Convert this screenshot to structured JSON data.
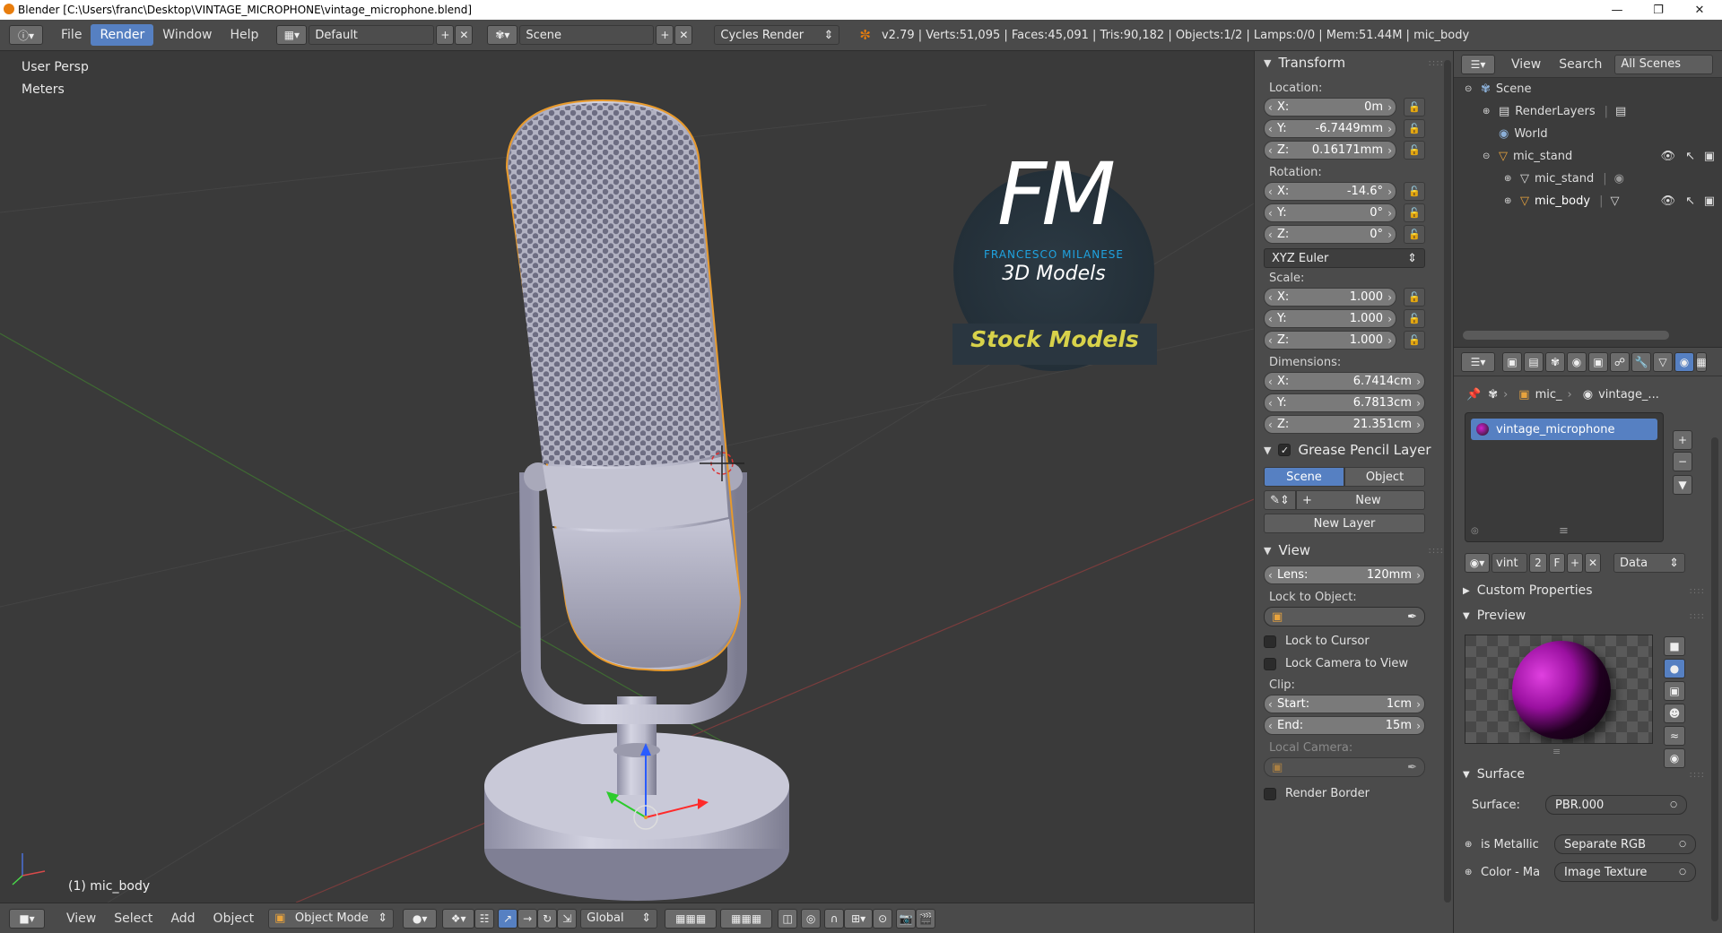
{
  "window": {
    "title": "Blender [C:\\Users\\franc\\Desktop\\VINTAGE_MICROPHONE\\vintage_microphone.blend]",
    "min_icon": "minimize-icon",
    "max_icon": "maximize-icon",
    "close_icon": "close-icon"
  },
  "topbar": {
    "menus": [
      "File",
      "Render",
      "Window",
      "Help"
    ],
    "active_menu": "Render",
    "screen_layout": "Default",
    "scene": "Scene",
    "engine": "Cycles Render",
    "stats": "v2.79 | Verts:51,095 | Faces:45,091 | Tris:90,182 | Objects:1/2 | Lamps:0/0 | Mem:51.44M | mic_body"
  },
  "viewport": {
    "view_name": "User Persp",
    "units": "Meters",
    "object_label": "(1) mic_body",
    "logo": {
      "letters": "FM",
      "name": "FRANCESCO MILANESE",
      "subtitle": "3D Models",
      "banner": "Stock Models"
    }
  },
  "header3d": {
    "menus": [
      "View",
      "Select",
      "Add",
      "Object"
    ],
    "mode": "Object Mode",
    "orientation": "Global"
  },
  "npanel": {
    "transform_title": "Transform",
    "location_label": "Location:",
    "location": [
      {
        "axis": "X:",
        "value": "0m"
      },
      {
        "axis": "Y:",
        "value": "-6.7449mm"
      },
      {
        "axis": "Z:",
        "value": "0.16171mm"
      }
    ],
    "rotation_label": "Rotation:",
    "rotation": [
      {
        "axis": "X:",
        "value": "-14.6°"
      },
      {
        "axis": "Y:",
        "value": "0°"
      },
      {
        "axis": "Z:",
        "value": "0°"
      }
    ],
    "rotation_mode": "XYZ Euler",
    "scale_label": "Scale:",
    "scale": [
      {
        "axis": "X:",
        "value": "1.000"
      },
      {
        "axis": "Y:",
        "value": "1.000"
      },
      {
        "axis": "Z:",
        "value": "1.000"
      }
    ],
    "dimensions_label": "Dimensions:",
    "dimensions": [
      {
        "axis": "X:",
        "value": "6.7414cm"
      },
      {
        "axis": "Y:",
        "value": "6.7813cm"
      },
      {
        "axis": "Z:",
        "value": "21.351cm"
      }
    ],
    "grease_title": "Grease Pencil Layer",
    "grease_tabs": [
      "Scene",
      "Object"
    ],
    "grease_active": "Scene",
    "new_label": "New",
    "new_layer_label": "New Layer",
    "view_title": "View",
    "lens_label": "Lens:",
    "lens_value": "120mm",
    "lock_object_label": "Lock to Object:",
    "lock_cursor_label": "Lock to Cursor",
    "lock_camera_label": "Lock Camera to View",
    "clip_label": "Clip:",
    "clip_start_label": "Start:",
    "clip_start": "1cm",
    "clip_end_label": "End:",
    "clip_end": "15m",
    "local_camera_label": "Local Camera:",
    "render_border_label": "Render Border"
  },
  "outliner": {
    "menus": [
      "View",
      "Search"
    ],
    "filter": "All Scenes",
    "rows": [
      {
        "label": "Scene"
      },
      {
        "label": "RenderLayers"
      },
      {
        "label": "World"
      },
      {
        "label": "mic_stand"
      },
      {
        "label": "mic_stand"
      },
      {
        "label": "mic_body"
      }
    ]
  },
  "properties": {
    "breadcrumb_object": "mic_",
    "breadcrumb_material": "vintage_...",
    "material_slot": "vintage_microphone",
    "mat_name_short": "vint",
    "mat_users": "2",
    "fake_user": "F",
    "link_mode": "Data",
    "custom_props_title": "Custom Properties",
    "preview_title": "Preview",
    "surface_title": "Surface",
    "surface_label": "Surface:",
    "surface_value": "PBR.000",
    "is_metallic_label": "is Metallic",
    "is_metallic_value": "Separate RGB",
    "color_label": "Color - Ma",
    "color_value": "Image Texture"
  },
  "colors": {
    "accent": "#5680c2",
    "viewport_bg": "#3a3a3a",
    "panel_bg": "#4b4b4b",
    "selection_outline": "#e89a2c",
    "logo_blue": "#1fa3e0",
    "logo_yellow": "#d8d24a"
  }
}
